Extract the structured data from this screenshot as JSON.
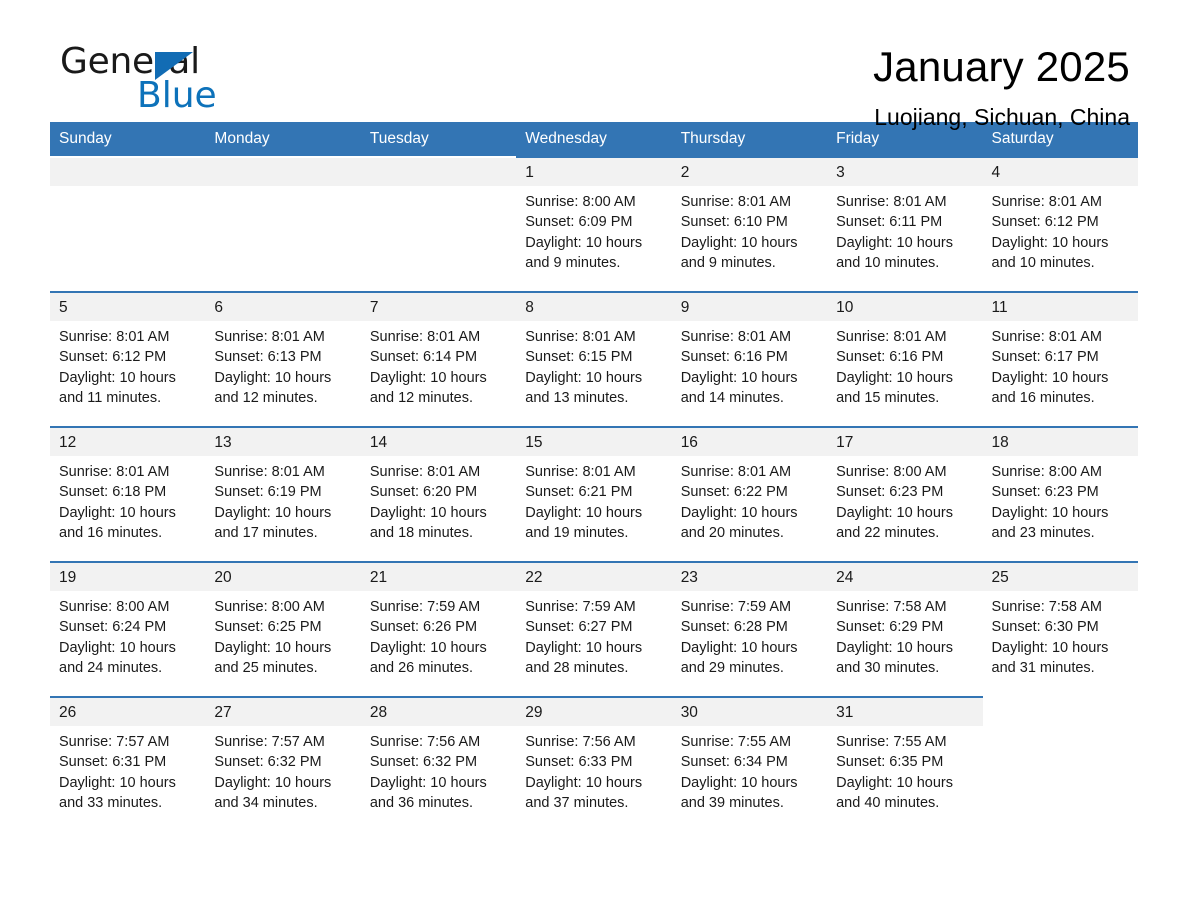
{
  "brand": {
    "name_part1": "General",
    "name_part2": "Blue",
    "triangle_color": "#126cb4",
    "blue_color": "#0d72ba"
  },
  "header": {
    "title": "January 2025",
    "subtitle": "Luojiang, Sichuan, China"
  },
  "theme": {
    "header_bg": "#3375b4",
    "row_border": "#3375b4",
    "daynum_bg": "#f2f2f2",
    "page_bg": "#ffffff",
    "text": "#1a1a1a"
  },
  "weekday_headers": [
    "Sunday",
    "Monday",
    "Tuesday",
    "Wednesday",
    "Thursday",
    "Friday",
    "Saturday"
  ],
  "labels": {
    "sunrise_prefix": "Sunrise:",
    "sunset_prefix": "Sunset:",
    "daylight_prefix": "Daylight:"
  },
  "weeks": [
    [
      {
        "day": "",
        "blank": true,
        "sunrise": "",
        "sunset": "",
        "daylight_line1": "",
        "daylight_line2": ""
      },
      {
        "day": "",
        "blank": true,
        "sunrise": "",
        "sunset": "",
        "daylight_line1": "",
        "daylight_line2": ""
      },
      {
        "day": "",
        "blank": true,
        "sunrise": "",
        "sunset": "",
        "daylight_line1": "",
        "daylight_line2": ""
      },
      {
        "day": "1",
        "blank": false,
        "sunrise": "Sunrise: 8:00 AM",
        "sunset": "Sunset: 6:09 PM",
        "daylight_line1": "Daylight: 10 hours",
        "daylight_line2": "and 9 minutes."
      },
      {
        "day": "2",
        "blank": false,
        "sunrise": "Sunrise: 8:01 AM",
        "sunset": "Sunset: 6:10 PM",
        "daylight_line1": "Daylight: 10 hours",
        "daylight_line2": "and 9 minutes."
      },
      {
        "day": "3",
        "blank": false,
        "sunrise": "Sunrise: 8:01 AM",
        "sunset": "Sunset: 6:11 PM",
        "daylight_line1": "Daylight: 10 hours",
        "daylight_line2": "and 10 minutes."
      },
      {
        "day": "4",
        "blank": false,
        "sunrise": "Sunrise: 8:01 AM",
        "sunset": "Sunset: 6:12 PM",
        "daylight_line1": "Daylight: 10 hours",
        "daylight_line2": "and 10 minutes."
      }
    ],
    [
      {
        "day": "5",
        "blank": false,
        "sunrise": "Sunrise: 8:01 AM",
        "sunset": "Sunset: 6:12 PM",
        "daylight_line1": "Daylight: 10 hours",
        "daylight_line2": "and 11 minutes."
      },
      {
        "day": "6",
        "blank": false,
        "sunrise": "Sunrise: 8:01 AM",
        "sunset": "Sunset: 6:13 PM",
        "daylight_line1": "Daylight: 10 hours",
        "daylight_line2": "and 12 minutes."
      },
      {
        "day": "7",
        "blank": false,
        "sunrise": "Sunrise: 8:01 AM",
        "sunset": "Sunset: 6:14 PM",
        "daylight_line1": "Daylight: 10 hours",
        "daylight_line2": "and 12 minutes."
      },
      {
        "day": "8",
        "blank": false,
        "sunrise": "Sunrise: 8:01 AM",
        "sunset": "Sunset: 6:15 PM",
        "daylight_line1": "Daylight: 10 hours",
        "daylight_line2": "and 13 minutes."
      },
      {
        "day": "9",
        "blank": false,
        "sunrise": "Sunrise: 8:01 AM",
        "sunset": "Sunset: 6:16 PM",
        "daylight_line1": "Daylight: 10 hours",
        "daylight_line2": "and 14 minutes."
      },
      {
        "day": "10",
        "blank": false,
        "sunrise": "Sunrise: 8:01 AM",
        "sunset": "Sunset: 6:16 PM",
        "daylight_line1": "Daylight: 10 hours",
        "daylight_line2": "and 15 minutes."
      },
      {
        "day": "11",
        "blank": false,
        "sunrise": "Sunrise: 8:01 AM",
        "sunset": "Sunset: 6:17 PM",
        "daylight_line1": "Daylight: 10 hours",
        "daylight_line2": "and 16 minutes."
      }
    ],
    [
      {
        "day": "12",
        "blank": false,
        "sunrise": "Sunrise: 8:01 AM",
        "sunset": "Sunset: 6:18 PM",
        "daylight_line1": "Daylight: 10 hours",
        "daylight_line2": "and 16 minutes."
      },
      {
        "day": "13",
        "blank": false,
        "sunrise": "Sunrise: 8:01 AM",
        "sunset": "Sunset: 6:19 PM",
        "daylight_line1": "Daylight: 10 hours",
        "daylight_line2": "and 17 minutes."
      },
      {
        "day": "14",
        "blank": false,
        "sunrise": "Sunrise: 8:01 AM",
        "sunset": "Sunset: 6:20 PM",
        "daylight_line1": "Daylight: 10 hours",
        "daylight_line2": "and 18 minutes."
      },
      {
        "day": "15",
        "blank": false,
        "sunrise": "Sunrise: 8:01 AM",
        "sunset": "Sunset: 6:21 PM",
        "daylight_line1": "Daylight: 10 hours",
        "daylight_line2": "and 19 minutes."
      },
      {
        "day": "16",
        "blank": false,
        "sunrise": "Sunrise: 8:01 AM",
        "sunset": "Sunset: 6:22 PM",
        "daylight_line1": "Daylight: 10 hours",
        "daylight_line2": "and 20 minutes."
      },
      {
        "day": "17",
        "blank": false,
        "sunrise": "Sunrise: 8:00 AM",
        "sunset": "Sunset: 6:23 PM",
        "daylight_line1": "Daylight: 10 hours",
        "daylight_line2": "and 22 minutes."
      },
      {
        "day": "18",
        "blank": false,
        "sunrise": "Sunrise: 8:00 AM",
        "sunset": "Sunset: 6:23 PM",
        "daylight_line1": "Daylight: 10 hours",
        "daylight_line2": "and 23 minutes."
      }
    ],
    [
      {
        "day": "19",
        "blank": false,
        "sunrise": "Sunrise: 8:00 AM",
        "sunset": "Sunset: 6:24 PM",
        "daylight_line1": "Daylight: 10 hours",
        "daylight_line2": "and 24 minutes."
      },
      {
        "day": "20",
        "blank": false,
        "sunrise": "Sunrise: 8:00 AM",
        "sunset": "Sunset: 6:25 PM",
        "daylight_line1": "Daylight: 10 hours",
        "daylight_line2": "and 25 minutes."
      },
      {
        "day": "21",
        "blank": false,
        "sunrise": "Sunrise: 7:59 AM",
        "sunset": "Sunset: 6:26 PM",
        "daylight_line1": "Daylight: 10 hours",
        "daylight_line2": "and 26 minutes."
      },
      {
        "day": "22",
        "blank": false,
        "sunrise": "Sunrise: 7:59 AM",
        "sunset": "Sunset: 6:27 PM",
        "daylight_line1": "Daylight: 10 hours",
        "daylight_line2": "and 28 minutes."
      },
      {
        "day": "23",
        "blank": false,
        "sunrise": "Sunrise: 7:59 AM",
        "sunset": "Sunset: 6:28 PM",
        "daylight_line1": "Daylight: 10 hours",
        "daylight_line2": "and 29 minutes."
      },
      {
        "day": "24",
        "blank": false,
        "sunrise": "Sunrise: 7:58 AM",
        "sunset": "Sunset: 6:29 PM",
        "daylight_line1": "Daylight: 10 hours",
        "daylight_line2": "and 30 minutes."
      },
      {
        "day": "25",
        "blank": false,
        "sunrise": "Sunrise: 7:58 AM",
        "sunset": "Sunset: 6:30 PM",
        "daylight_line1": "Daylight: 10 hours",
        "daylight_line2": "and 31 minutes."
      }
    ],
    [
      {
        "day": "26",
        "blank": false,
        "sunrise": "Sunrise: 7:57 AM",
        "sunset": "Sunset: 6:31 PM",
        "daylight_line1": "Daylight: 10 hours",
        "daylight_line2": "and 33 minutes."
      },
      {
        "day": "27",
        "blank": false,
        "sunrise": "Sunrise: 7:57 AM",
        "sunset": "Sunset: 6:32 PM",
        "daylight_line1": "Daylight: 10 hours",
        "daylight_line2": "and 34 minutes."
      },
      {
        "day": "28",
        "blank": false,
        "sunrise": "Sunrise: 7:56 AM",
        "sunset": "Sunset: 6:32 PM",
        "daylight_line1": "Daylight: 10 hours",
        "daylight_line2": "and 36 minutes."
      },
      {
        "day": "29",
        "blank": false,
        "sunrise": "Sunrise: 7:56 AM",
        "sunset": "Sunset: 6:33 PM",
        "daylight_line1": "Daylight: 10 hours",
        "daylight_line2": "and 37 minutes."
      },
      {
        "day": "30",
        "blank": false,
        "sunrise": "Sunrise: 7:55 AM",
        "sunset": "Sunset: 6:34 PM",
        "daylight_line1": "Daylight: 10 hours",
        "daylight_line2": "and 39 minutes."
      },
      {
        "day": "31",
        "blank": false,
        "sunrise": "Sunrise: 7:55 AM",
        "sunset": "Sunset: 6:35 PM",
        "daylight_line1": "Daylight: 10 hours",
        "daylight_line2": "and 40 minutes."
      },
      {
        "day": "",
        "blank": true,
        "sunrise": "",
        "sunset": "",
        "daylight_line1": "",
        "daylight_line2": ""
      }
    ]
  ]
}
